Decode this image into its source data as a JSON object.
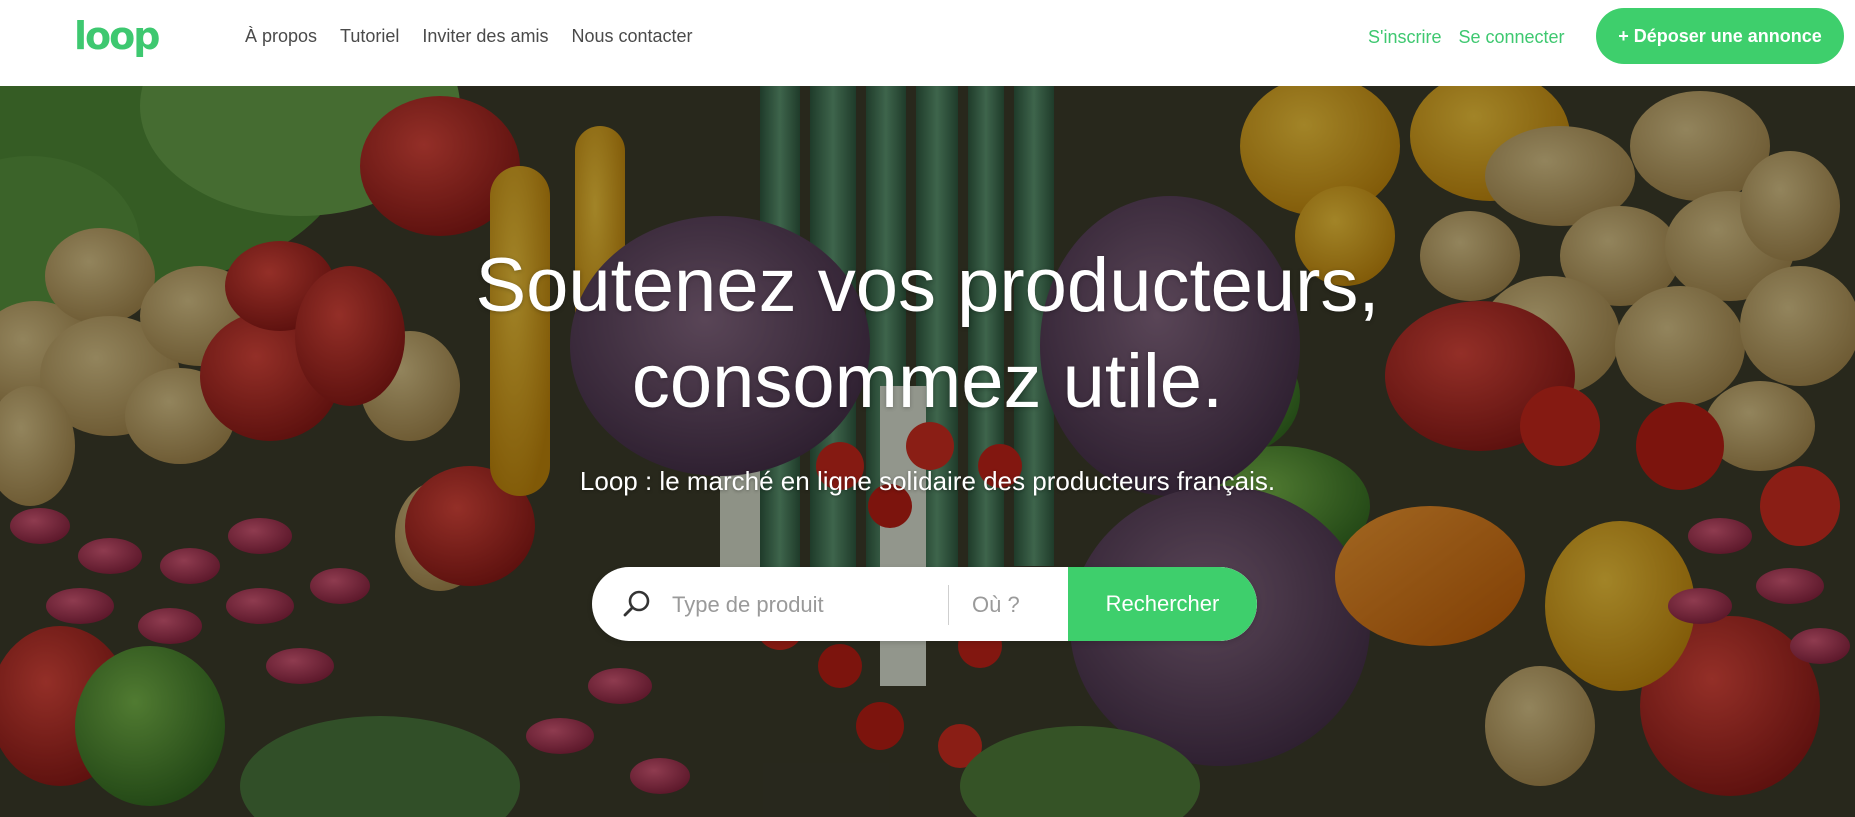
{
  "brand": {
    "logo_text": "loop",
    "color": "#3ec870"
  },
  "nav": {
    "items": [
      {
        "label": "À propos"
      },
      {
        "label": "Tutoriel"
      },
      {
        "label": "Inviter des amis"
      },
      {
        "label": "Nous contacter"
      }
    ]
  },
  "auth": {
    "signup_label": "S'inscrire",
    "login_label": "Se connecter"
  },
  "post_button": {
    "label": "+ Déposer une annonce",
    "color": "#3ecf6c"
  },
  "hero": {
    "title_line1": "Soutenez vos producteurs,",
    "title_line2": "consommez utile.",
    "subtitle": "Loop : le marché en ligne solidaire des producteurs français.",
    "background": "vegetables-photo"
  },
  "search": {
    "icon": "search-icon",
    "product_placeholder": "Type de produit",
    "place_placeholder": "Où ?",
    "button_label": "Rechercher"
  }
}
